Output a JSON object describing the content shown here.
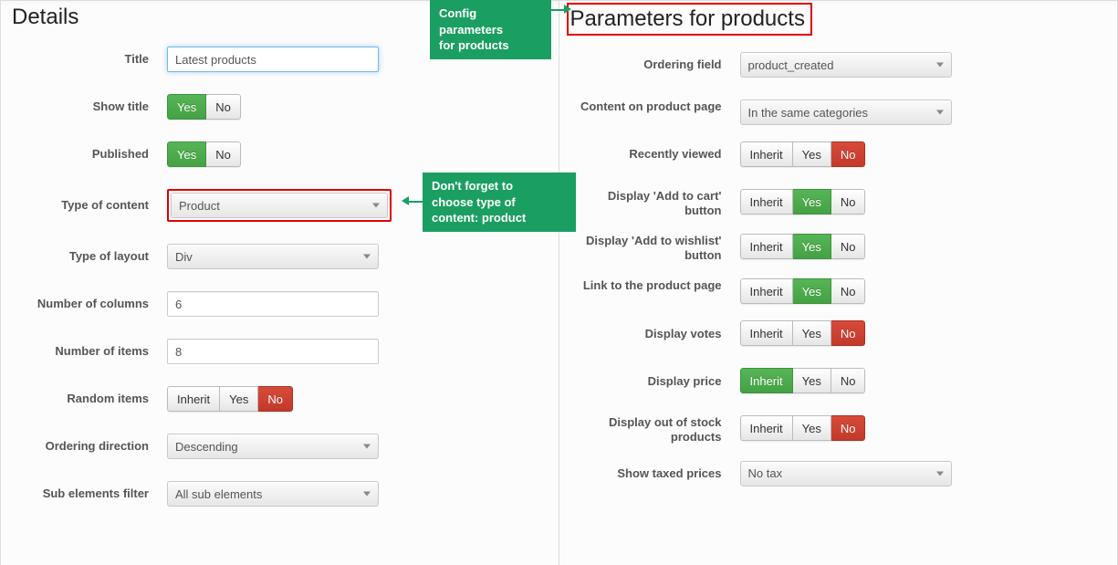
{
  "callouts": {
    "params": "Config\nparameters\nfor products",
    "typecontent": "Don't forget to\nchoose type of\ncontent: product"
  },
  "left": {
    "title": "Details",
    "fields": {
      "title_label": "Title",
      "title_value": "Latest products",
      "show_title_label": "Show title",
      "published_label": "Published",
      "type_content_label": "Type of content",
      "type_content_value": "Product",
      "type_layout_label": "Type of layout",
      "type_layout_value": "Div",
      "num_cols_label": "Number of columns",
      "num_cols_value": "6",
      "num_items_label": "Number of items",
      "num_items_value": "8",
      "random_items_label": "Random items",
      "ordering_dir_label": "Ordering direction",
      "ordering_dir_value": "Descending",
      "sub_el_label": "Sub elements filter",
      "sub_el_value": "All sub elements"
    }
  },
  "right": {
    "title": "Parameters for products",
    "fields": {
      "ordering_field_label": "Ordering field",
      "ordering_field_value": "product_created",
      "content_page_label": "Content on product page",
      "content_page_value": "In the same categories",
      "recently_viewed_label": "Recently viewed",
      "addcart_label": "Display 'Add to cart' button",
      "wishlist_label": "Display 'Add to wishlist' button",
      "link_page_label": "Link to the product page",
      "display_votes_label": "Display votes",
      "display_price_label": "Display price",
      "display_oos_label": "Display out of stock products",
      "taxed_label": "Show taxed prices",
      "taxed_value": "No tax"
    }
  },
  "btns": {
    "yes": "Yes",
    "no": "No",
    "inherit": "Inherit"
  }
}
